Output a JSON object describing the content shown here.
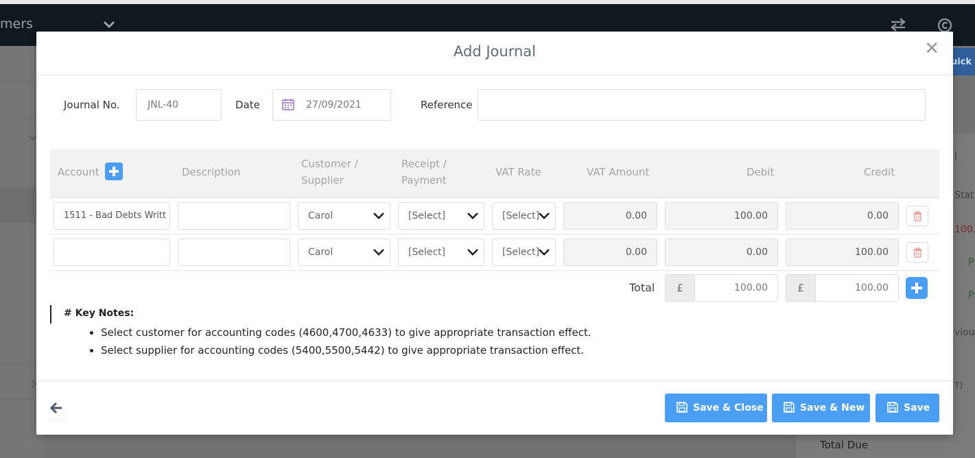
{
  "background": {
    "nav_text": "mers",
    "quick_label": "uick",
    "right_cells": [
      "l",
      "Stat",
      "100.",
      "P",
      "P",
      "vious",
      "T)"
    ],
    "total_due": "Total Due"
  },
  "modal": {
    "title": "Add Journal",
    "close_label": "✕",
    "journal_no_label": "Journal No.",
    "journal_no_value": "JNL-40",
    "date_label": "Date",
    "date_value": "27/09/2021",
    "reference_label": "Reference",
    "reference_value": "",
    "columns": {
      "account": "Account",
      "description": "Description",
      "customer_supplier_1": "Customer /",
      "customer_supplier_2": "Supplier",
      "receipt_payment_1": "Receipt /",
      "receipt_payment_2": "Payment",
      "vat_rate": "VAT Rate",
      "vat_amount": "VAT Amount",
      "debit": "Debit",
      "credit": "Credit"
    },
    "rows": [
      {
        "account": "1511 - Bad Debts Writt",
        "description": "",
        "customer": "Carol",
        "receipt": "[Select]",
        "vat_rate": "[Select]",
        "vat_amount": "0.00",
        "debit": "100.00",
        "credit": "0.00"
      },
      {
        "account": "",
        "description": "",
        "customer": "Carol",
        "receipt": "[Select]",
        "vat_rate": "[Select]",
        "vat_amount": "0.00",
        "debit": "0.00",
        "credit": "100.00"
      }
    ],
    "total_label": "Total",
    "currency": "£",
    "total_debit": "100.00",
    "total_credit": "100.00",
    "notes_title": "# Key Notes:",
    "notes": [
      "Select customer for accounting codes (4600,4700,4633) to give appropriate transaction effect.",
      "Select supplier for accounting codes (5400,5500,5442) to give appropriate transaction effect."
    ],
    "buttons": {
      "save_close": "Save & Close",
      "save_new": "Save & New",
      "save": "Save"
    }
  },
  "colors": {
    "primary": "#4a9ff5",
    "title": "#5b6b78",
    "danger_icon": "#e8897f",
    "calendar_icon": "#9b6fc6"
  }
}
